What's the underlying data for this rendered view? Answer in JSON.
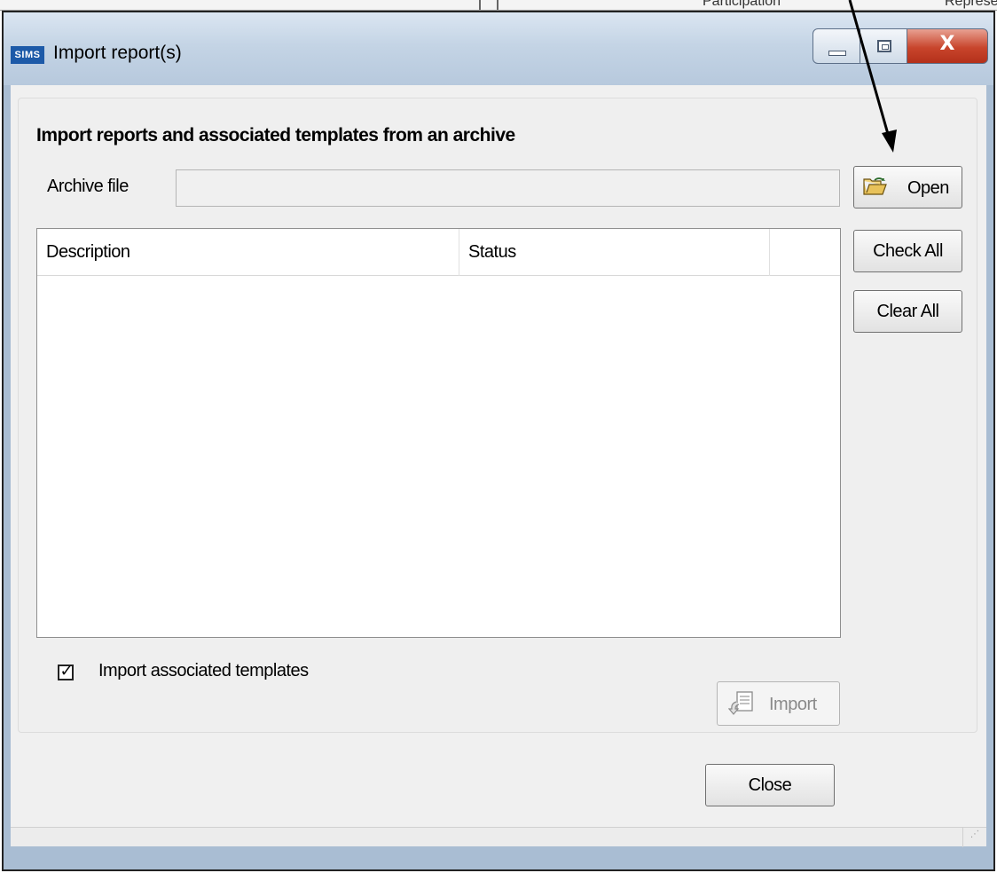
{
  "background_window": {
    "column_1": "Participation",
    "column_2": "Represe"
  },
  "window": {
    "logo_text": "SIMS",
    "title": "Import report(s)",
    "minimize_icon": "minimize-icon",
    "maximize_icon": "maximize-icon",
    "close_glyph": "X"
  },
  "section": {
    "heading": "Import reports and associated templates from an archive"
  },
  "archive": {
    "label": "Archive file",
    "value": ""
  },
  "buttons": {
    "open": "Open",
    "open_icon": "open-folder-icon",
    "check_all": "Check All",
    "clear_all": "Clear All",
    "import": "Import",
    "import_icon": "import-document-icon",
    "close": "Close"
  },
  "list": {
    "columns": [
      "Description",
      "Status",
      ""
    ],
    "rows": []
  },
  "options": {
    "import_templates_label": "Import associated templates",
    "import_templates_checked": true,
    "check_glyph": "✓"
  },
  "colors": {
    "logo_blue": "#1d5aa8",
    "close_red": "#c8452c",
    "frame_blue": "#a9bdd3"
  }
}
